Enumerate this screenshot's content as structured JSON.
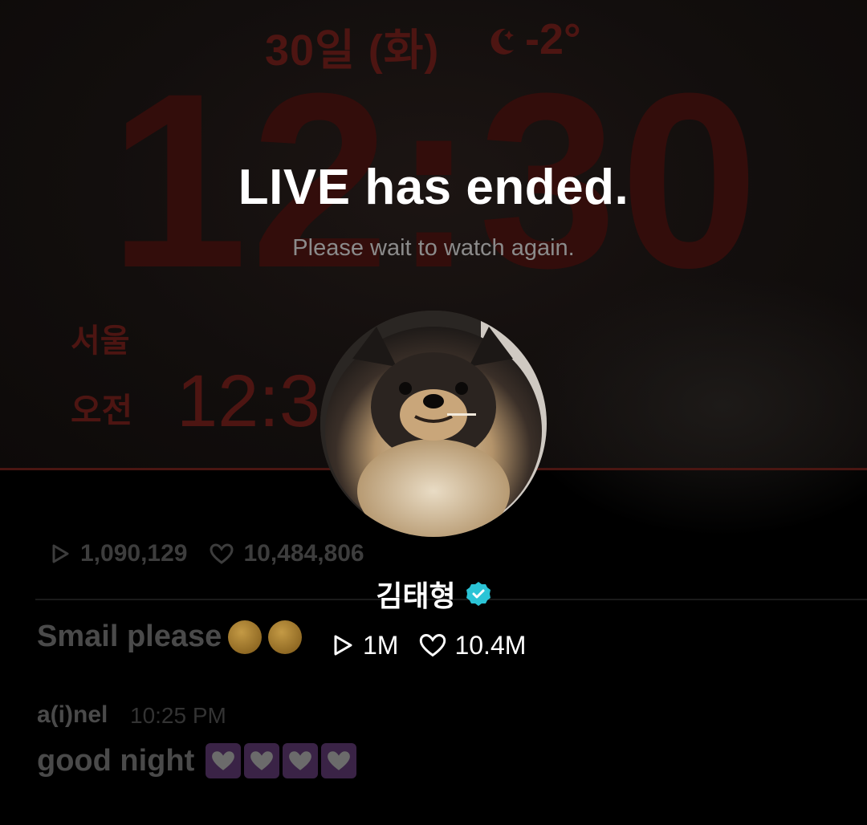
{
  "background": {
    "lockscreen_date": "30일 (화)",
    "lockscreen_weather": "-2°",
    "lockscreen_time": "12:30",
    "world_clock_city": "서울",
    "world_clock_ampm": "오전",
    "world_clock_time": "12:3",
    "faded_stats": {
      "plays": "1,090,129",
      "likes": "10,484,806"
    },
    "chat": [
      {
        "message": "Smail please"
      },
      {
        "user": "a(i)nel",
        "time": "10:25 PM",
        "message": "good night"
      }
    ]
  },
  "overlay": {
    "title": "LIVE has ended.",
    "subtitle": "Please wait to watch again.",
    "avatar_icon": "pomeranian-dog-photo",
    "channel_name": "김태형",
    "verified_icon": "verified-badge-icon",
    "stats": {
      "plays": "1M",
      "likes": "10.4M"
    }
  },
  "colors": {
    "lockscreen_red": "#4d1512",
    "verified": "#2bc4d6",
    "subtitle_gray": "#8b8b8b"
  }
}
